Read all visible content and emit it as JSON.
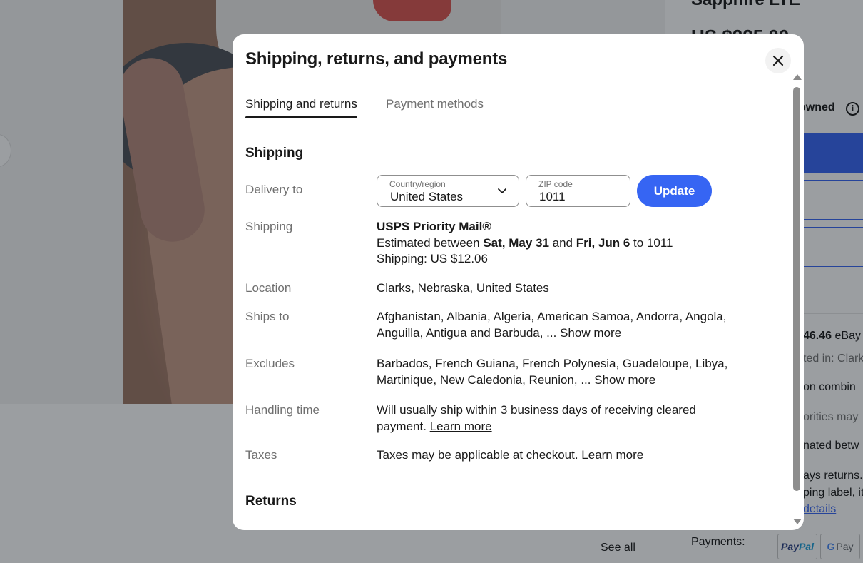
{
  "background": {
    "product_title": "Sapphire LTE",
    "price": "US $225.00",
    "condition": "owned",
    "shipping_price": "46.46",
    "shipping_carrier": "eBay",
    "located_in": "ted in: Clarks",
    "combine": "on combin",
    "authorities": "orities may",
    "estimated": "nated betw",
    "returns": "ays returns.",
    "label": "ping label, it",
    "details_link": "details",
    "see_all": "See all",
    "payments_label": "Payments:",
    "paypal_a": "Pay",
    "paypal_b": "Pal",
    "gpay": "Pay"
  },
  "modal": {
    "title": "Shipping, returns, and payments",
    "tabs": [
      {
        "label": "Shipping and returns",
        "active": true
      },
      {
        "label": "Payment methods",
        "active": false
      }
    ],
    "shipping_section": "Shipping",
    "returns_section": "Returns",
    "delivery": {
      "label": "Delivery to",
      "country_label": "Country/region",
      "country_value": "United States",
      "zip_label": "ZIP code",
      "zip_value": "1011",
      "update_label": "Update"
    },
    "shipping": {
      "label": "Shipping",
      "service": "USPS Priority Mail®",
      "est_prefix": "Estimated between ",
      "date_start": "Sat, May 31",
      "est_and": " and ",
      "date_end": "Fri, Jun 6",
      "est_suffix": " to 1011",
      "cost": "Shipping: US $12.06"
    },
    "location": {
      "label": "Location",
      "value": "Clarks, Nebraska, United States"
    },
    "ships_to": {
      "label": "Ships to",
      "value": "Afghanistan, Albania, Algeria, American Samoa, Andorra, Angola, Anguilla, Antigua and Barbuda, ... ",
      "link": "Show more"
    },
    "excludes": {
      "label": "Excludes",
      "value": "Barbados, French Guiana, French Polynesia, Guadeloupe, Libya, Martinique, New Caledonia, Reunion, ... ",
      "link": "Show more"
    },
    "handling": {
      "label": "Handling time",
      "value": "Will usually ship within 3 business days of receiving cleared payment. ",
      "link": "Learn more"
    },
    "taxes": {
      "label": "Taxes",
      "value": "Taxes may be applicable at checkout. ",
      "link": "Learn more"
    }
  },
  "colors": {
    "accent": "#3665f3",
    "text": "#191919",
    "muted": "#707070"
  },
  "icons": {
    "close": "close-icon",
    "chevron": "chevron-down-icon",
    "info": "info-icon"
  }
}
